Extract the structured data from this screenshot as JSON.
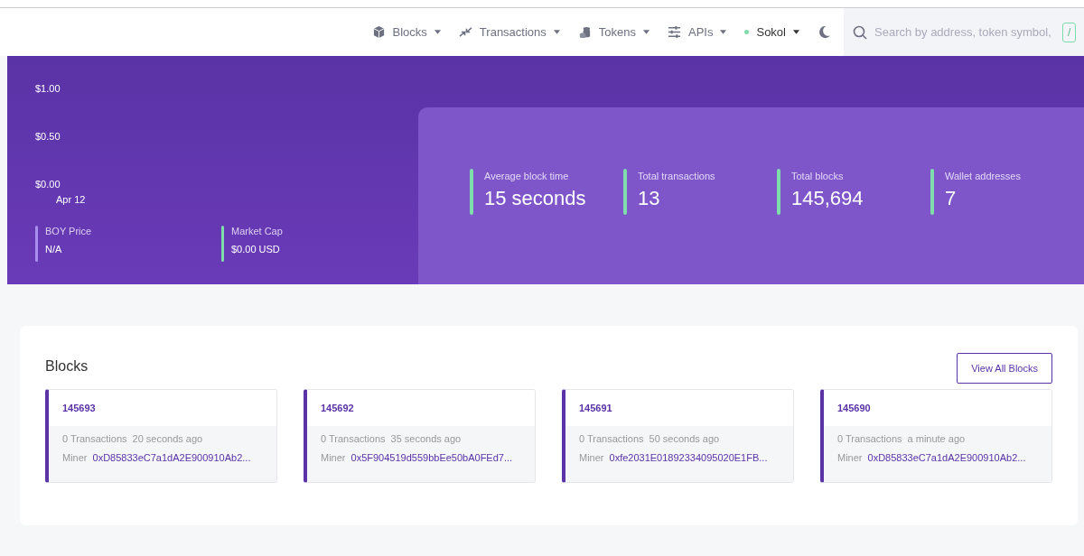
{
  "nav": {
    "items": [
      {
        "label": "Blocks",
        "kind": "menu"
      },
      {
        "label": "Transactions",
        "kind": "menu"
      },
      {
        "label": "Tokens",
        "kind": "menu"
      },
      {
        "label": "APIs",
        "kind": "menu"
      },
      {
        "label": "Sokol",
        "kind": "network"
      }
    ],
    "search": {
      "placeholder": "Search by address, token symbol,",
      "shortcut": "/"
    }
  },
  "price_chart": {
    "y_labels": [
      "$1.00",
      "$0.50",
      "$0.00"
    ],
    "x_label": "Apr 12"
  },
  "price_stats": [
    {
      "label": "BOY Price",
      "value": "N/A",
      "color": "#a98ef0"
    },
    {
      "label": "Market Cap",
      "value": "$0.00 USD",
      "color": "#7fdcab"
    }
  ],
  "chain_stats": [
    {
      "label": "Average block time",
      "value": "15 seconds"
    },
    {
      "label": "Total transactions",
      "value": "13"
    },
    {
      "label": "Total blocks",
      "value": "145,694"
    },
    {
      "label": "Wallet addresses",
      "value": "7"
    }
  ],
  "blocks": {
    "title": "Blocks",
    "button": "View All Blocks",
    "items": [
      {
        "number": "145693",
        "transactions": "0 Transactions",
        "age": "20 seconds ago",
        "miner_label": "Miner",
        "miner": "0xD85833eC7a1dA2E900910Ab2..."
      },
      {
        "number": "145692",
        "transactions": "0 Transactions",
        "age": "35 seconds ago",
        "miner_label": "Miner",
        "miner": "0x5F904519d559bbEe50bA0FEd7..."
      },
      {
        "number": "145691",
        "transactions": "0 Transactions",
        "age": "50 seconds ago",
        "miner_label": "Miner",
        "miner": "0xfe2031E01892334095020E1FB..."
      },
      {
        "number": "145690",
        "transactions": "0 Transactions",
        "age": "a minute ago",
        "miner_label": "Miner",
        "miner": "0xD85833eC7a1dA2E900910Ab2..."
      }
    ]
  }
}
